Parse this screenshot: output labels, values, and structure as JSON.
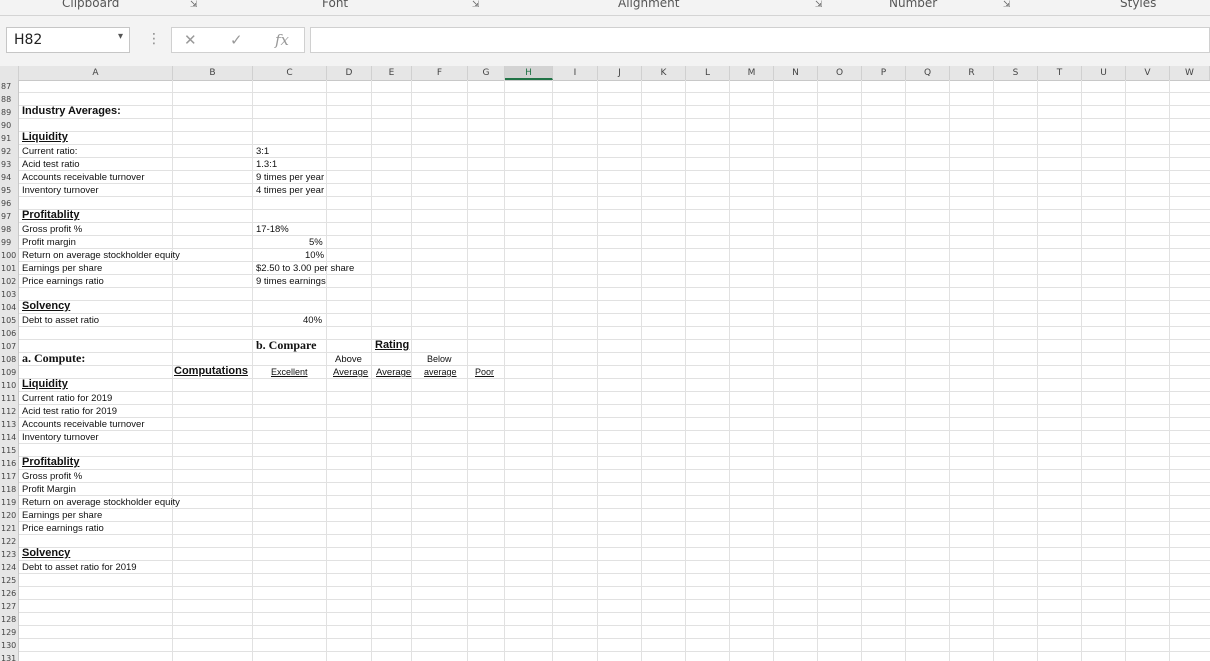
{
  "ribbon": {
    "groups": [
      "Clipboard",
      "Font",
      "Alignment",
      "Number",
      "Styles"
    ],
    "launcher_icon": "dialog-launcher-icon"
  },
  "formula_bar": {
    "name_box": "H82",
    "cancel_icon": "✕",
    "enter_icon": "✓",
    "fx": "fx",
    "formula": ""
  },
  "columns": [
    "A",
    "B",
    "C",
    "D",
    "E",
    "F",
    "G",
    "H",
    "I",
    "J",
    "K",
    "L",
    "M",
    "N",
    "O",
    "P",
    "Q",
    "R",
    "S",
    "T",
    "U",
    "V",
    "W"
  ],
  "selected_column": "H",
  "rows": [
    "87",
    "88",
    "89",
    "90",
    "91",
    "92",
    "93",
    "94",
    "95",
    "96",
    "97",
    "98",
    "99",
    "100",
    "101",
    "102",
    "103",
    "104",
    "105",
    "106",
    "107",
    "108",
    "109",
    "110",
    "111",
    "112",
    "113",
    "114",
    "115",
    "116",
    "117",
    "118",
    "119",
    "120",
    "121",
    "122",
    "123",
    "124",
    "125",
    "126",
    "127",
    "128",
    "129",
    "130",
    "131"
  ],
  "cells": {
    "r89": "Industry Averages:",
    "r91": "Liquidity",
    "r92a": "Current ratio:",
    "r92c": "3:1",
    "r93a": "Acid test ratio",
    "r93c": "1.3:1",
    "r94a": "Accounts receivable turnover",
    "r94c": "9 times per year",
    "r95a": "Inventory turnover",
    "r95c": "4 times per year",
    "r97": "Profitablity",
    "r98a": "Gross profit %",
    "r98c": "17-18%",
    "r99a": "Profit margin",
    "r99c": "5%",
    "r100a": "Return on average stockholder equity",
    "r100c": "10%",
    "r101a": "Earnings per share",
    "r101c": "$2.50 to 3.00 per share",
    "r102a": "Price earnings ratio",
    "r102c": "9 times earnings",
    "r104": "Solvency",
    "r105a": "Debt to asset ratio",
    "r105c": "40%",
    "r107c": "b. Compare",
    "r107e": "Rating",
    "r108a": "a. Compute:",
    "r108d": "Above",
    "r108f": "Below",
    "r109b": "Computations",
    "r109c": "Excellent",
    "r109d": "Average",
    "r109e": "Average",
    "r109f": "average",
    "r109g": "Poor",
    "r110": "Liquidity",
    "r111": "Current ratio for 2019",
    "r112": "Acid test ratio for 2019",
    "r113": "Accounts receivable turnover",
    "r114": "Inventory turnover",
    "r116": "Profitablity",
    "r117": "Gross profit %",
    "r118": "Profit Margin",
    "r119": "Return on average stockholder equity",
    "r120": "Earnings per share",
    "r121": "Price earnings ratio",
    "r123": "Solvency",
    "r124": "Debt to asset ratio for 2019"
  }
}
